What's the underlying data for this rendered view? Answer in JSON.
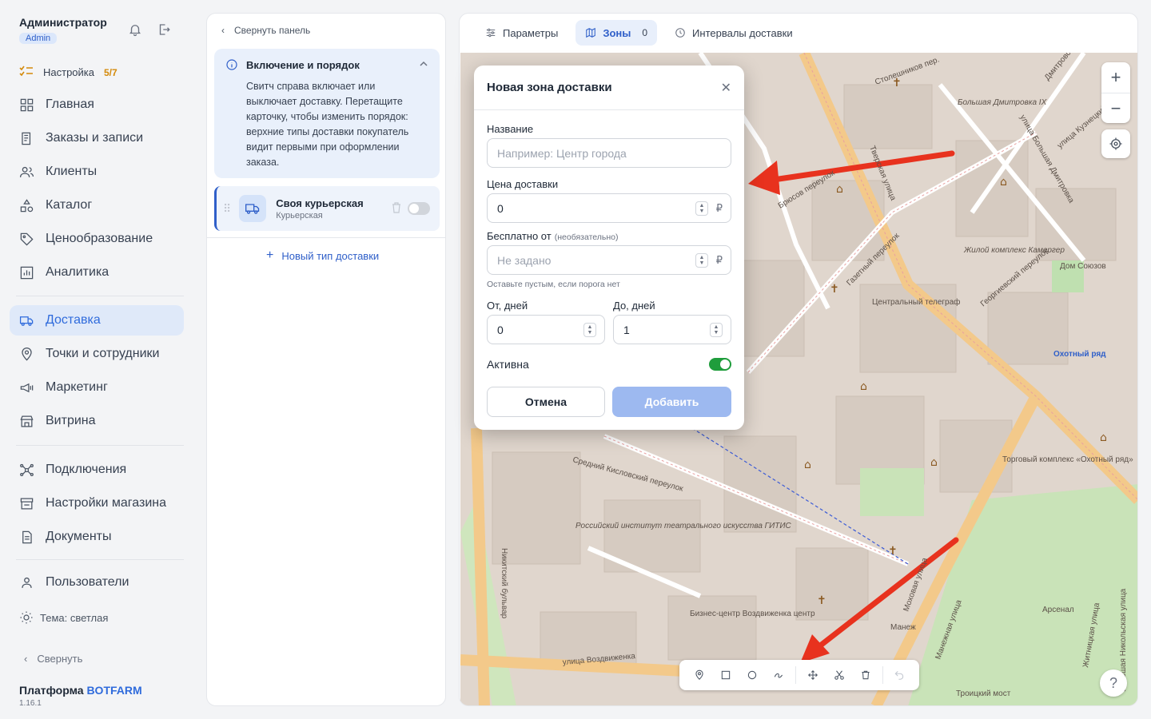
{
  "user": {
    "name": "Администратор",
    "role": "Admin"
  },
  "setup": {
    "label": "Настройка",
    "count": "5/7"
  },
  "nav": {
    "main": [
      "Главная",
      "Заказы и записи",
      "Клиенты",
      "Каталог",
      "Ценообразование",
      "Аналитика"
    ],
    "ops": [
      "Доставка",
      "Точки и сотрудники",
      "Маркетинг",
      "Витрина"
    ],
    "system": [
      "Подключения",
      "Настройки магазина",
      "Документы"
    ],
    "users": "Пользователи",
    "theme": "Тема: светлая",
    "collapse": "Свернуть"
  },
  "brand": {
    "prefix": "Платформа",
    "name": "BOTFARM",
    "version": "1.16.1"
  },
  "panel": {
    "collapse": "Свернуть панель",
    "info_title": "Включение и порядок",
    "info_text": "Свитч справа включает или выключает доставку. Перетащите карточку, чтобы изменить порядок: верхние типы доставки покупатель видит первыми при оформлении заказа.",
    "card_title": "Своя курьерская",
    "card_sub": "Курьерская",
    "new_type": "Новый тип доставки"
  },
  "tabs": [
    {
      "label": "Параметры"
    },
    {
      "label": "Зоны",
      "badge": "0"
    },
    {
      "label": "Интервалы доставки"
    }
  ],
  "modal": {
    "title": "Новая зона доставки",
    "name_label": "Название",
    "name_placeholder": "Например: Центр города",
    "price_label": "Цена доставки",
    "price_value": "0",
    "currency": "₽",
    "free_label": "Бесплатно от",
    "free_optional": "(необязательно)",
    "free_placeholder": "Не задано",
    "free_hint": "Оставьте пустым, если порога нет",
    "from_label": "От, дней",
    "from_value": "0",
    "to_label": "До, дней",
    "to_value": "1",
    "active_label": "Активна",
    "cancel": "Отмена",
    "add": "Добавить"
  },
  "map_labels": [
    "Столешников пер.",
    "Дмитровский пер.",
    "Большая Дмитровка IX",
    "улица Большая Дмитровка",
    "улица Кузнецкий",
    "Брюсов переулок",
    "Тверская улица",
    "Газетный переулок",
    "Центральный телеграф",
    "Жилой комплекс Камергер",
    "Георгиевский переулок",
    "Дом Союзов",
    "Охотный ряд",
    "Средний Кисловский переулок",
    "Российский институт театрального искусства ГИТИС",
    "Торговый комплекс «Охотный ряд»",
    "улица Воздвиженка",
    "Бизнес-центр Воздвиженка центр",
    "Моховая улица",
    "Манеж",
    "Арсенал",
    "Никитский бульвар",
    "Троицкий мост",
    "Манежная улица",
    "Житницкая улица",
    "Большая Никольская улица"
  ]
}
